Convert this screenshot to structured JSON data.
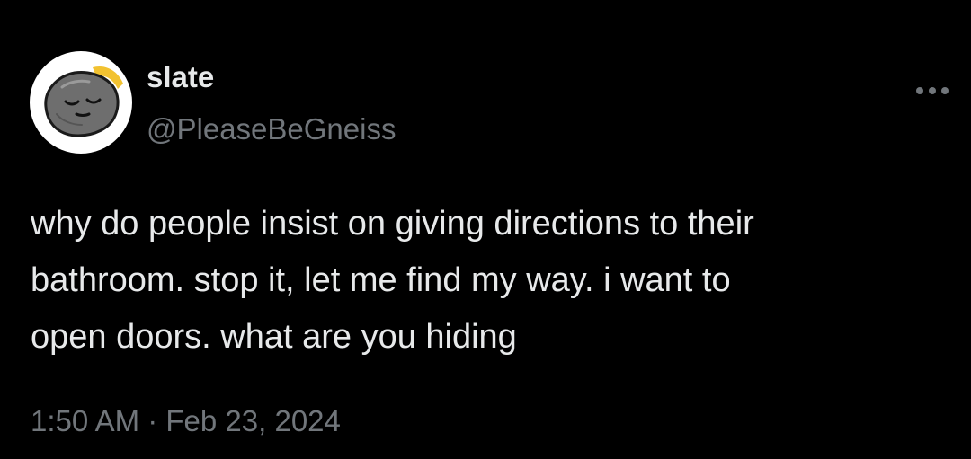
{
  "author": {
    "display_name": "slate",
    "handle": "@PleaseBeGneiss",
    "avatar_icon": "grumpy-rock-avatar"
  },
  "actions": {
    "more_icon": "more-options-icon"
  },
  "tweet": {
    "text_lines": [
      "why do people insist on giving directions to their",
      "bathroom. stop it, let me find my way. i want to",
      "open doors. what are you hiding"
    ],
    "timestamp": "1:50 AM · Feb 23, 2024"
  },
  "colors": {
    "background": "#000000",
    "primary_text": "#e7e9ea",
    "secondary_text": "#71767b",
    "avatar_background": "#ffffff",
    "avatar_accent": "#f2c230"
  }
}
